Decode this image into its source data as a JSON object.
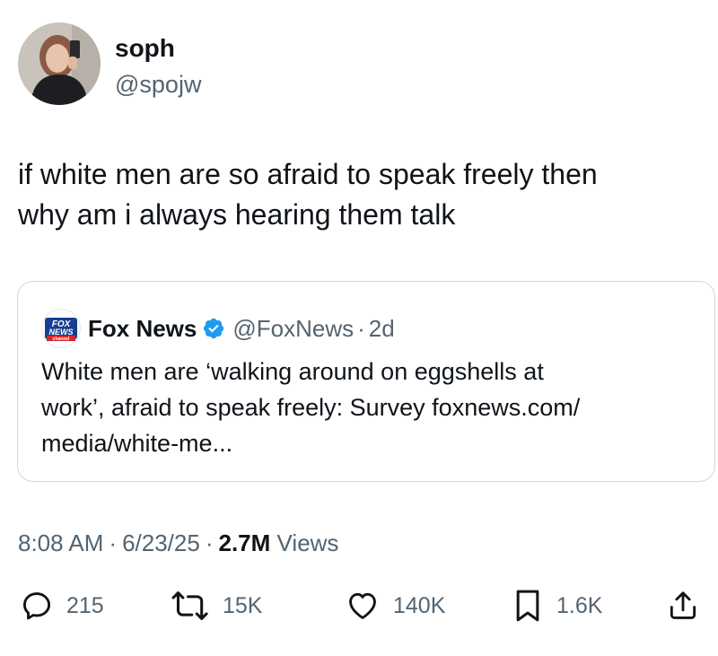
{
  "author": {
    "display_name": "soph",
    "handle": "@spojw"
  },
  "tweet": {
    "text_line1": "if white men are so afraid to speak freely then",
    "text_line2": "why am i always hearing them talk"
  },
  "quote": {
    "logo_text_top": "FOX",
    "logo_text_mid": "NEWS",
    "logo_text_bottom": "channel",
    "display_name": "Fox News",
    "handle": "@FoxNews",
    "separator": "·",
    "age": "2d",
    "text_line1": "White men are ‘walking around on eggshells at",
    "text_line2": "work’, afraid to speak freely: Survey foxnews.com/",
    "text_line3": "media/white-me..."
  },
  "meta": {
    "time": "8:08 AM",
    "separator": "·",
    "date": "6/23/25",
    "views_count": "2.7M",
    "views_label": "Views"
  },
  "actions": {
    "replies": "215",
    "reposts": "15K",
    "likes": "140K",
    "bookmarks": "1.6K"
  },
  "colors": {
    "text": "#0f1419",
    "secondary": "#536471",
    "border": "#cfd9de",
    "verified": "#1d9bf0",
    "fox_blue": "#16408f",
    "fox_red": "#d8262c"
  }
}
